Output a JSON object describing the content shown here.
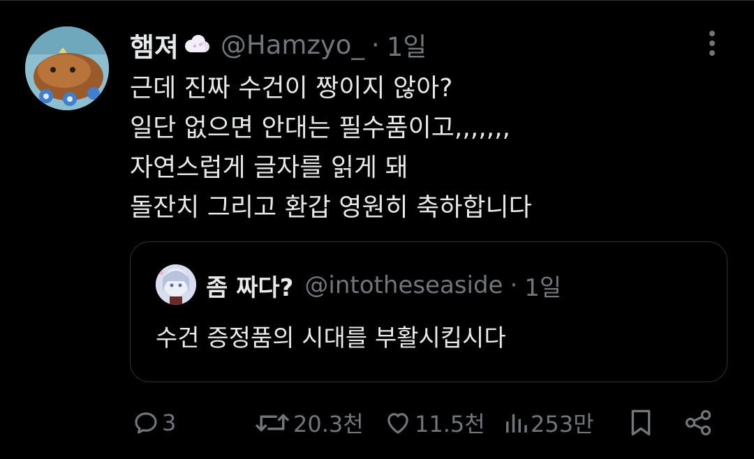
{
  "tweet": {
    "display_name": "햄져",
    "name_emoji": "cloud-emoji",
    "handle": "@Hamzyo_",
    "separator": "·",
    "time": "1일",
    "text_lines": [
      "근데 진짜 수건이 짱이지 않아?",
      "일단 없으면 안대는 필수품이고,,,,,,,",
      "자연스럽게 글자를 읽게 돼",
      "돌잔치 그리고 환갑 영원히 축하합니다"
    ]
  },
  "quote": {
    "display_name": "좀 짜다?",
    "handle": "@intotheseaside",
    "separator": "·",
    "time": "1일",
    "text": "수건 증정품의 시대를 부활시킵시다"
  },
  "actions": {
    "reply_count": "3",
    "retweet_count": "20.3천",
    "like_count": "11.5천",
    "views_count": "253만"
  },
  "colors": {
    "background": "#000000",
    "text_primary": "#e7e9ea",
    "text_secondary": "#71767b",
    "border": "#2f3336"
  }
}
